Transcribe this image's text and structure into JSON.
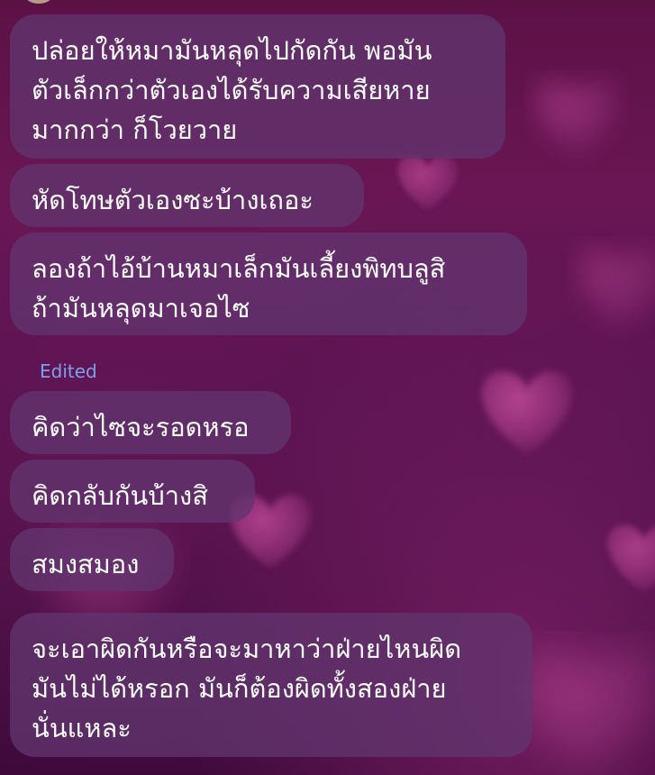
{
  "chat": {
    "messages": [
      {
        "text": "ปล่อยให้หมามันหลุดไปกัดกัน พอมัน\nตัวเล็กกว่าตัวเองได้รับความเสียหาย\nมากกว่า ก็โวยวาย"
      },
      {
        "text": "หัดโทษตัวเองซะบ้างเถอะ"
      },
      {
        "text": "ลองถ้าไอ้บ้านหมาเล็กมันเลี้ยงพิทบลูสิ\nถ้ามันหลุดมาเจอไซ"
      },
      {
        "text": "คิดว่าไซจะรอดหรอ"
      },
      {
        "text": "คิดกลับกันบ้างสิ"
      },
      {
        "text": "สมงสมอง"
      },
      {
        "text": "จะเอาผิดกันหรือจะมาหาว่าฝ่ายไหนผิด\nมันไม่ได้หรอก มันก็ต้องผิดทั้งสองฝ่าย\nนั่นแหละ"
      }
    ],
    "edited_label": "Edited"
  },
  "colors": {
    "bubble": "#62346e",
    "text": "#ffffff",
    "edited": "#7aa2e8",
    "background_top": "#5c1145",
    "background_bottom": "#3d0a3a",
    "heart": "#a0357f"
  },
  "decorations": {
    "background_icon": "heart-icon"
  }
}
